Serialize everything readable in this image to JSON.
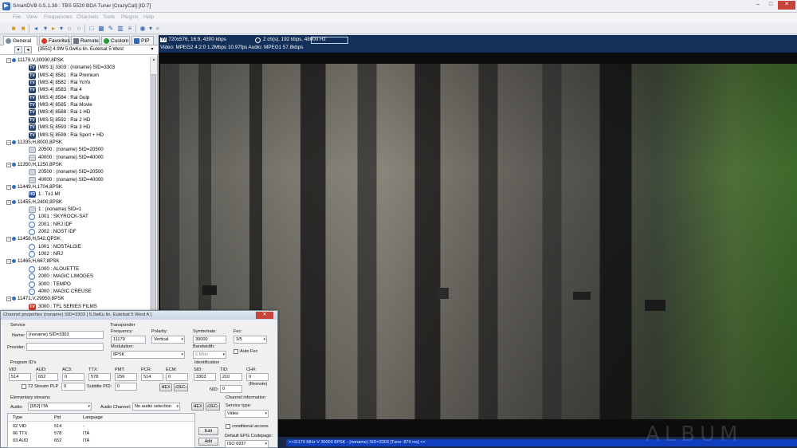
{
  "window": {
    "title": "SmartDVB 0.5.1.38 : TBS 5520 BDA Tuner [CrazyCat] [ID:7]",
    "min": "–",
    "max": "□",
    "close": "✕"
  },
  "menu": [
    "File",
    "View",
    "Frequencies",
    "Channels",
    "Tools",
    "Plugins",
    "Help"
  ],
  "tabs": [
    {
      "label": "General",
      "color": "#7a8fa8"
    },
    {
      "label": "Favorites",
      "color": "#d23a2a"
    },
    {
      "label": "Remote",
      "color": "#6b7280"
    },
    {
      "label": "Custom",
      "color": "#2e9b3a"
    },
    {
      "label": "PIP",
      "color": "#3767b1"
    }
  ],
  "satellite_selector": "[3551] 4.9W  5.0wKu lin. Eutelsat 5 West",
  "tree": [
    {
      "type": "tp",
      "label": "11179,V,30000,8PSK"
    },
    {
      "type": "ch",
      "icon": "tv",
      "label": "[MIS:1] 3303 : (noname) SID=3303"
    },
    {
      "type": "ch",
      "icon": "tv",
      "label": "[MIS:4] 8581 : Rai Premium"
    },
    {
      "type": "ch",
      "icon": "tv",
      "label": "[MIS:4] 8582 : Rai YoYo"
    },
    {
      "type": "ch",
      "icon": "tv",
      "label": "[MIS:4] 8583 : Rai 4"
    },
    {
      "type": "ch",
      "icon": "tv",
      "label": "[MIS:4] 8584 : Rai Gulp"
    },
    {
      "type": "ch",
      "icon": "tv",
      "label": "[MIS:4] 8585 : Rai Movie"
    },
    {
      "type": "ch",
      "icon": "tv",
      "label": "[MIS:4] 8588 : Rai 1 HD"
    },
    {
      "type": "ch",
      "icon": "tv",
      "label": "[MIS:5] 8592 : Rai 2 HD"
    },
    {
      "type": "ch",
      "icon": "tv",
      "label": "[MIS:5] 8593 : Rai 3 HD"
    },
    {
      "type": "ch",
      "icon": "tv",
      "label": "[MIS:5] 8599 : Rai Sport + HD"
    },
    {
      "type": "tp",
      "label": "11335,H,8000,8PSK"
    },
    {
      "type": "ch",
      "icon": "data",
      "label": "20500 : (noname) SID=20500"
    },
    {
      "type": "ch",
      "icon": "data",
      "label": "40000 : (noname) SID=40000"
    },
    {
      "type": "tp",
      "label": "11350,H,1250,8PSK"
    },
    {
      "type": "ch",
      "icon": "data",
      "label": "20500 : (noname) SID=20500"
    },
    {
      "type": "ch",
      "icon": "data",
      "label": "40000 : (noname) SID=40000"
    },
    {
      "type": "tp",
      "label": "11449,H,1704,8PSK"
    },
    {
      "type": "ch",
      "icon": "hd",
      "label": "1 : Tx1 MI"
    },
    {
      "type": "tp",
      "label": "11455,H,2400,8PSK"
    },
    {
      "type": "ch",
      "icon": "data",
      "label": "1 : (noname) SID=1"
    },
    {
      "type": "ch",
      "icon": "radio",
      "label": "1001 : SKYROCK-SAT"
    },
    {
      "type": "ch",
      "icon": "radio",
      "label": "2001 : NRJ IDF"
    },
    {
      "type": "ch",
      "icon": "radio",
      "label": "2002 : NOST IDF"
    },
    {
      "type": "tp",
      "label": "11458,H,542,QPSK"
    },
    {
      "type": "ch",
      "icon": "radio",
      "label": "1001 : NOSTALGIE"
    },
    {
      "type": "ch",
      "icon": "radio",
      "label": "1002 : NRJ"
    },
    {
      "type": "tp",
      "label": "11465,H,667,8PSK"
    },
    {
      "type": "ch",
      "icon": "radio",
      "label": "1000 : ALOUETTE"
    },
    {
      "type": "ch",
      "icon": "radio",
      "label": "2000 : MAGIC LIMOGES"
    },
    {
      "type": "ch",
      "icon": "radio",
      "label": "3000 : TEMPO"
    },
    {
      "type": "ch",
      "icon": "radio",
      "label": "4000 : MAGIC CREUSE"
    },
    {
      "type": "tp",
      "label": "11471,V,29950,8PSK"
    },
    {
      "type": "ch",
      "icon": "red",
      "label": "3000 : TFL SERIES FILMS"
    }
  ],
  "video_info": {
    "line1": "720x576, 16:9, 4300 kbps",
    "audio_line": "2 ch(s), 192 kbps, 48000 Hz",
    "line2": "Video: MPEG2  4:2:0  1.2Mbps  10.97fps    Audio: MPEG1  57.8kbps"
  },
  "status_text": ">>11179 MHz V 30000 8PSK - (noname) SID=3303 [Tune: 874 ms] <<",
  "watermark": "ALBUM",
  "dialog": {
    "title": "Channel properties (noname) SID=3303 [ 5.0wKu lin. Eutelsat 5 West A ]",
    "service": {
      "group": "Service",
      "name_label": "Name:",
      "name_value": "(noname) SID=3303",
      "provider_label": "Provider:",
      "provider_value": ""
    },
    "transponder": {
      "group": "Transponder",
      "frequency_label": "Frequency:",
      "frequency_value": "11179",
      "polarity_label": "Polarity:",
      "polarity_value": "Vertical",
      "symbolrate_label": "Symbolrate:",
      "symbolrate_value": "30000",
      "fec_label": "Fec:",
      "fec_value": "3/5",
      "modulation_label": "Modulation:",
      "modulation_value": "8PSK",
      "bandwidth_label": "Bandwidth:",
      "bandwidth_value": "6 MHz",
      "autofec_label": "Auto Fec"
    },
    "program_ids": {
      "group": "Program ID's",
      "labels": [
        "VID:",
        "AUD:",
        "AC3:",
        "TTX:",
        "PMT:",
        "PCR:",
        "ECM:"
      ],
      "values": [
        "514",
        "652",
        "0",
        "578",
        "256",
        "514",
        "0"
      ],
      "t2_label": "T2 Stream PLP",
      "t2_value": "0",
      "subtitle_label": "Subtitle PID:",
      "subtitle_value": "0",
      "hex": "HEX",
      "dec": "‹DEC›"
    },
    "identification": {
      "group": "Identification",
      "labels": [
        "SID:",
        "TID:",
        "CH#:"
      ],
      "values": [
        "3303",
        "210",
        "0"
      ],
      "remote_label": "(Remote)",
      "nid_label": "NID:",
      "nid_value": "0"
    },
    "elementary": {
      "group": "Elementary streams",
      "audio_label": "Audio:",
      "audio_value": "[652] ITA",
      "audio_channel_label": "Audio Channel:",
      "audio_channel_value": "No audio selection",
      "hex": "HEX",
      "dec": "‹DEC›",
      "columns": [
        "Type",
        "Pid",
        "Language"
      ],
      "rows": [
        [
          "02 VID",
          "514",
          "-"
        ],
        [
          "06 TTX",
          "578",
          "ITA"
        ],
        [
          "03 AUD",
          "652",
          "ITA"
        ]
      ],
      "edit": "Edit",
      "add": "Add"
    },
    "channel_info": {
      "group": "Channel information",
      "service_type_label": "Service type:",
      "service_type_value": "Video",
      "conditional_label": "conditional access",
      "epg_label": "Default EPG Codepage:",
      "epg_value": "ISO 6937"
    }
  }
}
